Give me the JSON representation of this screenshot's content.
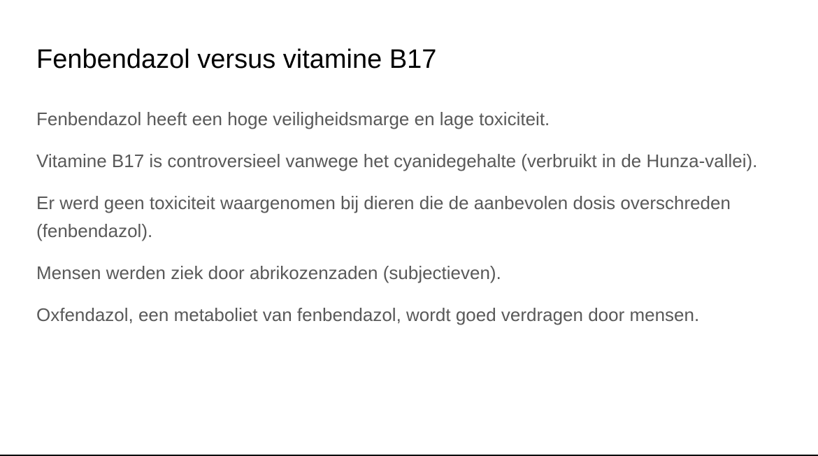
{
  "slide": {
    "title": "Fenbendazol versus vitamine B17",
    "points": [
      "Fenbendazol heeft een hoge veiligheidsmarge en lage toxiciteit.",
      "Vitamine B17 is controversieel vanwege het cyanidegehalte (verbruikt in de Hunza-vallei).",
      "Er werd geen toxiciteit waargenomen bij dieren die de aanbevolen dosis overschreden (fenbendazol).",
      "Mensen werden ziek door abrikozenzaden (subjectieven).",
      "Oxfendazol, een metaboliet van fenbendazol, wordt goed verdragen door mensen."
    ]
  },
  "colors": {
    "background": "#ffffff",
    "title": "#000000",
    "body_text": "#595959"
  }
}
